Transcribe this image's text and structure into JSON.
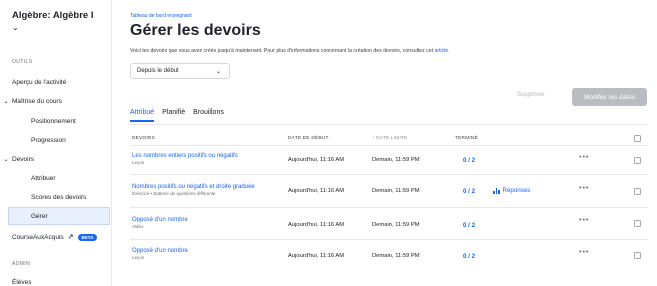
{
  "sidebar": {
    "course_title": "Algèbre: Algèbre I",
    "sections": {
      "tools": "OUTILS",
      "admin": "ADMIN"
    },
    "items": {
      "overview": "Aperçu de l'activité",
      "mastery": "Maîtrise du cours",
      "placement": "Positionnement",
      "progress": "Progression",
      "assignments": "Devoirs",
      "assign": "Attribuer",
      "scores": "Scores des devoirs",
      "manage": "Gérer",
      "course_ace": "CourseAuxAcquis",
      "course_ace_badge": "BETA",
      "students": "Élèves"
    }
  },
  "main": {
    "breadcrumb": "Tableau de bord enseignant",
    "title": "Gérer les devoirs",
    "intro_text": "Voici les devoirs que vous avez créés jusqu'à maintenant. Pour plus d'informations concernant la création des devoirs, consultez cet",
    "intro_link": "article.",
    "date_filter": "Depuis le début",
    "delete_label": "Supprimer",
    "edit_dates_label": "Modifier les dates",
    "tabs": [
      "Attribué",
      "Planifié",
      "Brouillons"
    ]
  },
  "table": {
    "headers": {
      "assignments": "DEVOIRS",
      "start_date": "DATE DE DÉBUT",
      "due_date": "↑ DATE LIMITE",
      "completed": "TERMINÉ"
    },
    "rows": [
      {
        "title": "Les nombres entiers positifs ou négatifs",
        "type": "Leçon",
        "start": "Aujourd'hui, 11:16 AM",
        "due": "Demain, 11:59 PM",
        "done": "0 / 2",
        "responses": ""
      },
      {
        "title": "Nombres positifs ou négatifs et droite graduée",
        "type": "Exercice • Batterie de questions différente",
        "start": "Aujourd'hui, 11:16 AM",
        "due": "Demain, 11:59 PM",
        "done": "0 / 2",
        "responses": "Réponses"
      },
      {
        "title": "Opposé d'un nombre",
        "type": "Vidéo",
        "start": "Aujourd'hui, 11:16 AM",
        "due": "Demain, 11:59 PM",
        "done": "0 / 2",
        "responses": ""
      },
      {
        "title": "Opposé d'un nombre",
        "type": "Leçon",
        "start": "Aujourd'hui, 11:16 AM",
        "due": "Demain, 11:59 PM",
        "done": "0 / 2",
        "responses": ""
      }
    ],
    "more_label": "•••"
  },
  "colors": {
    "accent": "#1865f2",
    "disabled": "#b9bcc1",
    "selected_bg": "#e8f0fe"
  },
  "icons": {
    "course_chevron": "chevron-down-icon",
    "external": "external-link-icon",
    "responses": "bar-chart-icon"
  }
}
